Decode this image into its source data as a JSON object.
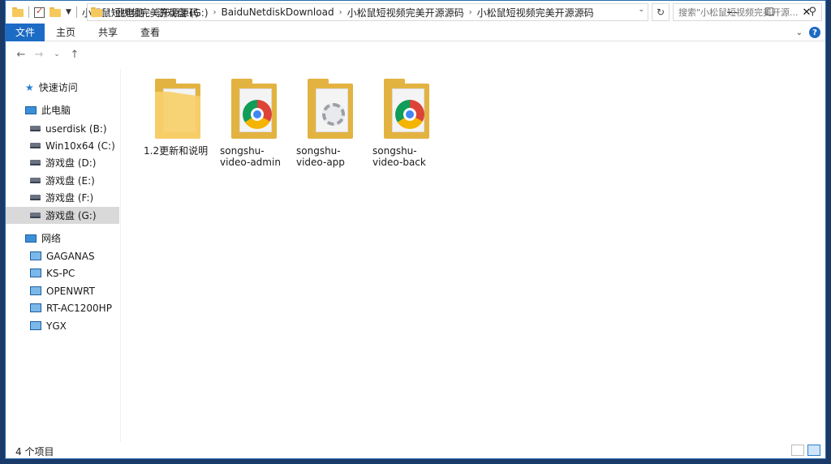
{
  "window": {
    "title": "小松鼠短视频完美开源源码"
  },
  "ribbon": {
    "tabs": [
      "文件",
      "主页",
      "共享",
      "查看"
    ]
  },
  "address": {
    "crumbs": [
      "此电脑",
      "游戏盘 (G:)",
      "BaiduNetdiskDownload",
      "小松鼠短视频完美开源源码",
      "小松鼠短视频完美开源源码"
    ],
    "search_placeholder": "搜索\"小松鼠短视频完美开源..."
  },
  "sidebar": {
    "quick_access": "快速访问",
    "this_pc": "此电脑",
    "drives": [
      "userdisk (B:)",
      "Win10x64 (C:)",
      "游戏盘 (D:)",
      "游戏盘 (E:)",
      "游戏盘 (F:)",
      "游戏盘 (G:)"
    ],
    "selected_drive_index": 5,
    "network": "网络",
    "hosts": [
      "GAGANAS",
      "KS-PC",
      "OPENWRT",
      "RT-AC1200HP",
      "YGX"
    ]
  },
  "files": [
    {
      "name": "1.2更新和说明",
      "icon": "document-folder-icon"
    },
    {
      "name": "songshu-video-admin",
      "icon": "chrome-folder-icon"
    },
    {
      "name": "songshu-video-app",
      "icon": "settings-folder-icon"
    },
    {
      "name": "songshu-video-back",
      "icon": "chrome-folder-icon"
    }
  ],
  "status": {
    "item_count": "4 个项目"
  },
  "colors": {
    "accent": "#1c6bc4",
    "folder": "#f7cf6a",
    "selected_row": "#d9d9d9"
  }
}
